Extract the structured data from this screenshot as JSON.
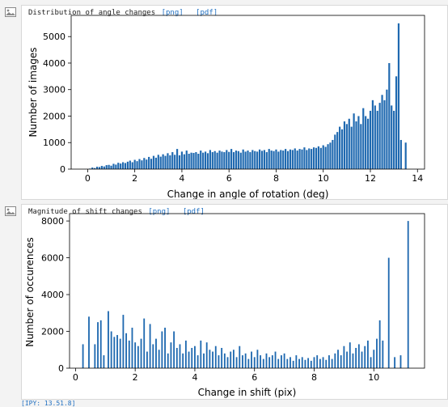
{
  "cells": [
    {
      "title": "Distribution of angle changes",
      "links": [
        "[png]",
        "[pdf]"
      ],
      "icon": "image-icon",
      "chart_data": {
        "type": "bar",
        "xlabel": "Change in angle of rotation (deg)",
        "ylabel": "Number of images",
        "xlim": [
          -0.7,
          14.3
        ],
        "ylim": [
          0,
          5800
        ],
        "xticks": [
          0,
          2,
          4,
          6,
          8,
          10,
          12,
          14
        ],
        "yticks": [
          0,
          1000,
          2000,
          3000,
          4000,
          5000
        ],
        "bin_width": 0.075,
        "x": [
          0.1,
          0.2,
          0.3,
          0.4,
          0.5,
          0.6,
          0.7,
          0.8,
          0.9,
          1.0,
          1.1,
          1.2,
          1.3,
          1.4,
          1.5,
          1.6,
          1.7,
          1.8,
          1.9,
          2.0,
          2.1,
          2.2,
          2.3,
          2.4,
          2.5,
          2.6,
          2.7,
          2.8,
          2.9,
          3.0,
          3.1,
          3.2,
          3.3,
          3.4,
          3.5,
          3.6,
          3.7,
          3.8,
          3.9,
          4.0,
          4.1,
          4.2,
          4.3,
          4.4,
          4.5,
          4.6,
          4.7,
          4.8,
          4.9,
          5.0,
          5.1,
          5.2,
          5.3,
          5.4,
          5.5,
          5.6,
          5.7,
          5.8,
          5.9,
          6.0,
          6.1,
          6.2,
          6.3,
          6.4,
          6.5,
          6.6,
          6.7,
          6.8,
          6.9,
          7.0,
          7.1,
          7.2,
          7.3,
          7.4,
          7.5,
          7.6,
          7.7,
          7.8,
          7.9,
          8.0,
          8.1,
          8.2,
          8.3,
          8.4,
          8.5,
          8.6,
          8.7,
          8.8,
          8.9,
          9.0,
          9.1,
          9.2,
          9.3,
          9.4,
          9.5,
          9.6,
          9.7,
          9.8,
          9.9,
          10.0,
          10.1,
          10.2,
          10.3,
          10.4,
          10.5,
          10.6,
          10.7,
          10.8,
          10.9,
          11.0,
          11.1,
          11.2,
          11.3,
          11.4,
          11.5,
          11.6,
          11.7,
          11.8,
          11.9,
          12.0,
          12.1,
          12.2,
          12.3,
          12.4,
          12.5,
          12.6,
          12.7,
          12.8,
          12.9,
          13.0,
          13.1,
          13.2,
          13.3,
          13.5
        ],
        "values": [
          20,
          60,
          40,
          90,
          80,
          120,
          100,
          150,
          160,
          130,
          200,
          170,
          240,
          210,
          260,
          230,
          280,
          320,
          260,
          350,
          300,
          380,
          330,
          420,
          360,
          460,
          390,
          500,
          430,
          540,
          470,
          560,
          500,
          600,
          520,
          640,
          540,
          760,
          520,
          660,
          560,
          700,
          580,
          620,
          610,
          640,
          580,
          700,
          620,
          660,
          600,
          720,
          640,
          680,
          620,
          700,
          660,
          640,
          720,
          650,
          760,
          640,
          700,
          680,
          620,
          740,
          660,
          700,
          640,
          720,
          680,
          660,
          740,
          690,
          720,
          640,
          760,
          700,
          680,
          740,
          660,
          720,
          700,
          760,
          680,
          740,
          720,
          780,
          700,
          760,
          740,
          820,
          720,
          780,
          760,
          820,
          800,
          860,
          800,
          900,
          840,
          940,
          1000,
          1100,
          1300,
          1400,
          1600,
          1500,
          1800,
          1700,
          1900,
          1600,
          2100,
          1800,
          2000,
          1700,
          2300,
          2000,
          1900,
          2200,
          2600,
          2400,
          2200,
          2500,
          2800,
          2600,
          3000,
          4000,
          2400,
          2200,
          3500,
          5500,
          1100,
          1000,
          3800
        ]
      }
    },
    {
      "title": "Magnitude of shift changes",
      "links": [
        "[png]",
        "[pdf]"
      ],
      "icon": "image-icon",
      "chart_data": {
        "type": "bar",
        "xlabel": "Change in shift (pix)",
        "ylabel": "Number of occurences",
        "xlim": [
          -0.2,
          11.7
        ],
        "ylim": [
          0,
          8400
        ],
        "xticks": [
          0,
          2,
          4,
          6,
          8,
          10
        ],
        "yticks": [
          0,
          2000,
          4000,
          6000,
          8000
        ],
        "bin_width": 0.05,
        "x": [
          0.25,
          0.45,
          0.65,
          0.75,
          0.85,
          0.95,
          1.1,
          1.2,
          1.3,
          1.4,
          1.5,
          1.6,
          1.7,
          1.8,
          1.9,
          2.0,
          2.1,
          2.2,
          2.3,
          2.4,
          2.5,
          2.6,
          2.7,
          2.8,
          2.9,
          3.0,
          3.1,
          3.2,
          3.3,
          3.4,
          3.5,
          3.6,
          3.7,
          3.8,
          3.9,
          4.0,
          4.1,
          4.2,
          4.3,
          4.4,
          4.5,
          4.6,
          4.7,
          4.8,
          4.9,
          5.0,
          5.1,
          5.2,
          5.3,
          5.4,
          5.5,
          5.6,
          5.7,
          5.8,
          5.9,
          6.0,
          6.1,
          6.2,
          6.3,
          6.4,
          6.5,
          6.6,
          6.7,
          6.8,
          6.9,
          7.0,
          7.1,
          7.2,
          7.3,
          7.4,
          7.5,
          7.6,
          7.7,
          7.8,
          7.9,
          8.0,
          8.1,
          8.2,
          8.3,
          8.4,
          8.5,
          8.6,
          8.7,
          8.8,
          8.9,
          9.0,
          9.1,
          9.2,
          9.3,
          9.4,
          9.5,
          9.6,
          9.7,
          9.8,
          9.9,
          10.0,
          10.1,
          10.2,
          10.3,
          10.5,
          10.7,
          10.9,
          11.15
        ],
        "values": [
          1300,
          2800,
          1300,
          2500,
          2600,
          700,
          3100,
          2000,
          1700,
          1800,
          1600,
          2900,
          1900,
          1500,
          2200,
          1400,
          1200,
          1600,
          2700,
          900,
          2400,
          1300,
          1600,
          1000,
          2000,
          2200,
          800,
          1400,
          2000,
          1100,
          1300,
          800,
          1500,
          900,
          1100,
          1200,
          700,
          1500,
          800,
          1400,
          1000,
          900,
          1200,
          700,
          1100,
          800,
          600,
          900,
          1000,
          600,
          1200,
          700,
          800,
          500,
          900,
          600,
          1000,
          700,
          500,
          800,
          600,
          700,
          900,
          500,
          700,
          800,
          500,
          600,
          400,
          700,
          500,
          600,
          450,
          550,
          400,
          600,
          700,
          500,
          600,
          450,
          700,
          500,
          800,
          1000,
          700,
          1200,
          900,
          1400,
          800,
          1100,
          1300,
          900,
          1200,
          1500,
          600,
          1000,
          1600,
          2600,
          1500,
          6000,
          600,
          700,
          8000
        ]
      }
    }
  ],
  "bottom_strip_text": "[IPY: 13.51.8]"
}
